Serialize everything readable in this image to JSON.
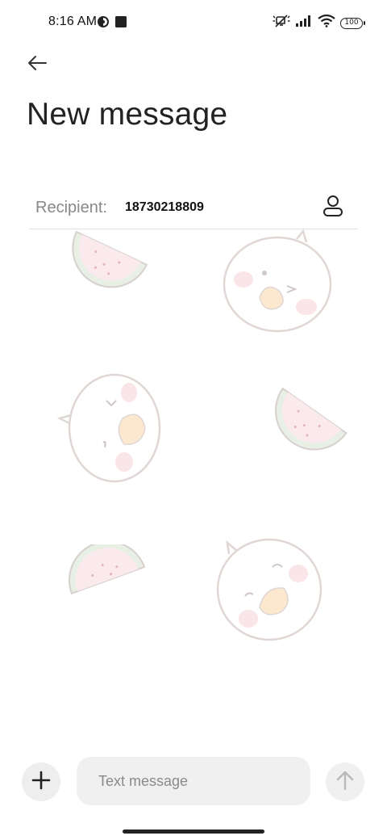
{
  "status_bar": {
    "time": "8:16 AM",
    "battery_level": "100",
    "icons": [
      "vpn-icon",
      "square-notification-icon",
      "mute-icon",
      "signal-icon",
      "wifi-icon",
      "battery-icon"
    ]
  },
  "header": {
    "title": "New message",
    "back_icon": "arrow-left-icon"
  },
  "recipient": {
    "label": "Recipient:",
    "value": "18730218809",
    "contact_icon": "person-icon"
  },
  "composer": {
    "placeholder": "Text message",
    "add_icon": "plus-icon",
    "send_icon": "arrow-up-icon"
  },
  "wallpaper": {
    "stickers": [
      "watermelon",
      "duck",
      "duck",
      "watermelon",
      "watermelon",
      "duck"
    ]
  },
  "colors": {
    "background": "#ffffff",
    "input_bg": "#f0f0f0",
    "label_gray": "#888888",
    "text_dark": "#222222",
    "sticker_pink": "#f7d9df",
    "sticker_green": "#d7e3cf",
    "sticker_beak": "#f8d7a8"
  }
}
